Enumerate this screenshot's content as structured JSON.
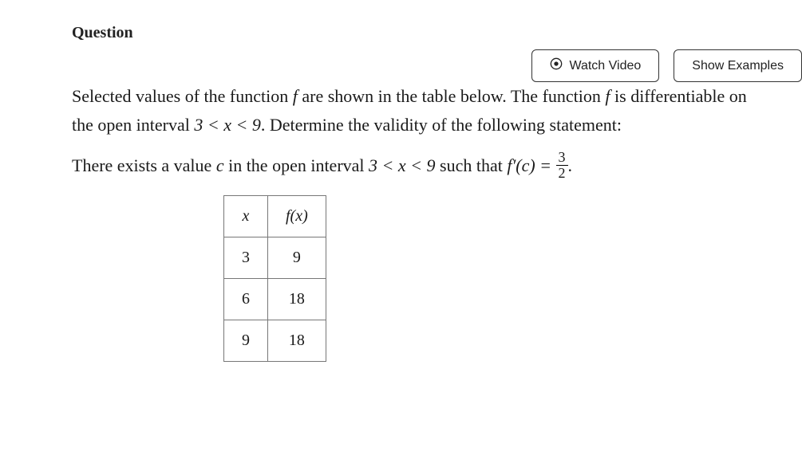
{
  "header": {
    "label": "Question"
  },
  "buttons": {
    "watch_video": "Watch Video",
    "show_examples": "Show Examples"
  },
  "problem": {
    "para1_pre": "Selected values of the function ",
    "para1_f": "f",
    "para1_mid": " are shown in the table below. The function ",
    "para1_f2": "f",
    "para1_post": " is differentiable on the open interval ",
    "para1_interval": "3 < x < 9",
    "para1_end": ". Determine the validity of the following statement:",
    "para2_pre": "There exists a value ",
    "para2_c": "c",
    "para2_mid": " in the open interval ",
    "para2_interval": "3 < x < 9",
    "para2_such": " such that ",
    "para2_fprime": "f′(c) = ",
    "para2_num": "3",
    "para2_den": "2",
    "para2_period": "."
  },
  "table": {
    "col1": "x",
    "col2": "f(x)",
    "rows": [
      {
        "x": "3",
        "fx": "9"
      },
      {
        "x": "6",
        "fx": "18"
      },
      {
        "x": "9",
        "fx": "18"
      }
    ]
  },
  "chart_data": {
    "type": "table",
    "columns": [
      "x",
      "f(x)"
    ],
    "rows": [
      [
        3,
        9
      ],
      [
        6,
        18
      ],
      [
        9,
        18
      ]
    ],
    "context": {
      "interval": "3 < x < 9",
      "statement_derivative_value": "3/2"
    }
  }
}
